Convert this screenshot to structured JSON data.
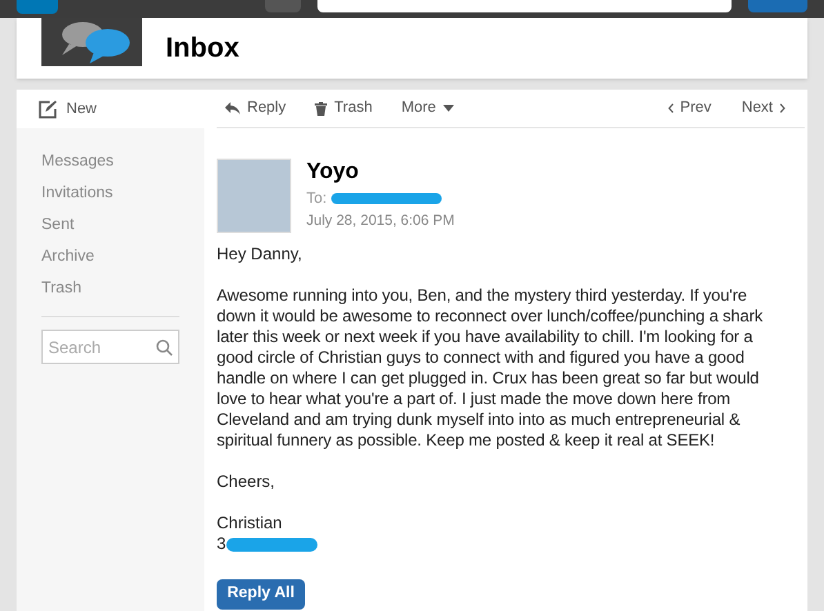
{
  "header": {
    "title": "Inbox"
  },
  "sidebar": {
    "new_label": "New",
    "items": [
      {
        "label": "Messages"
      },
      {
        "label": "Invitations"
      },
      {
        "label": "Sent"
      },
      {
        "label": "Archive"
      },
      {
        "label": "Trash"
      }
    ],
    "search": {
      "placeholder": "Search"
    }
  },
  "toolbar": {
    "left": [
      {
        "label": "Reply",
        "kind": "reply"
      },
      {
        "label": "Trash",
        "kind": "trash"
      },
      {
        "label": "More",
        "kind": "more"
      }
    ],
    "right": [
      {
        "label": "Prev",
        "kind": "prev"
      },
      {
        "label": "Next",
        "kind": "next"
      }
    ]
  },
  "message": {
    "sender": "Yoyo",
    "to_label": "To:",
    "date": "July 28, 2015, 6:06 PM",
    "greeting": "Hey Danny,",
    "body": "Awesome running into you, Ben, and the mystery third yesterday. If you're down it would be awesome to reconnect over lunch/coffee/punching a shark later this week or next week if you have availability to chill. I'm looking for a good circle of Christian guys to connect with and figured you have a good handle on where I can get plugged in. Crux has been great so far but would love to hear what you're a part of. I just made the move down here from Cleveland and am trying dunk myself into into as much entrepreneurial & spiritual funnery as possible. Keep me posted & keep it real at SEEK!",
    "closing": "Cheers,",
    "signature": "Christian",
    "phone_visible": "3"
  },
  "reply_all_label": "Reply All"
}
